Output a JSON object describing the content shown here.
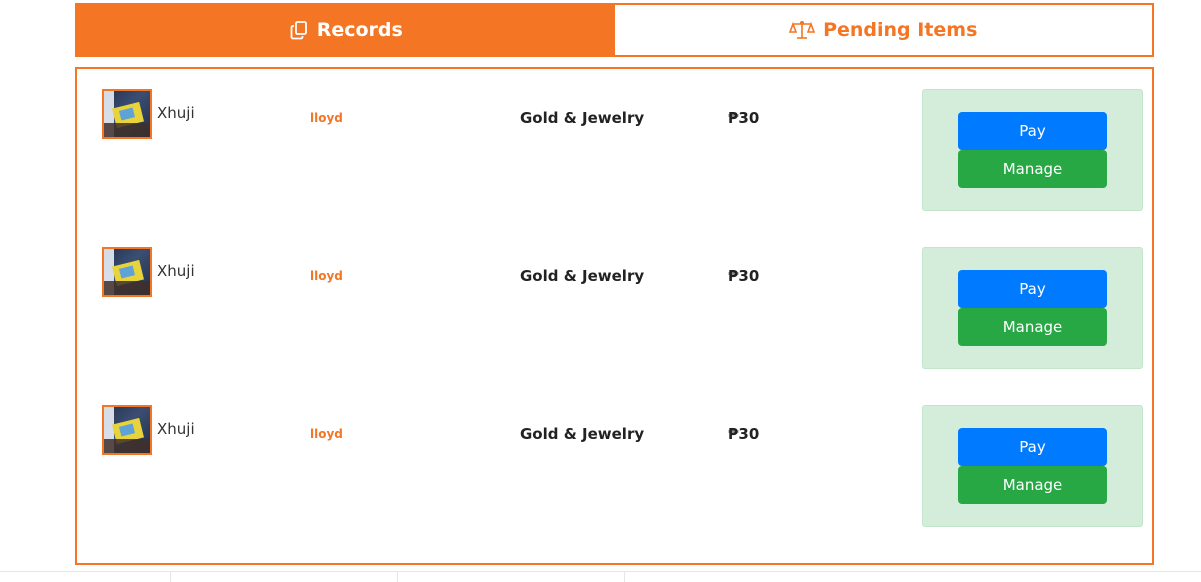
{
  "tabs": {
    "records": {
      "label": "Records",
      "icon": "copy-icon",
      "active": true
    },
    "pending": {
      "label": "Pending Items",
      "icon": "scale-icon",
      "active": false
    }
  },
  "colors": {
    "accent": "#f47624",
    "pay": "#007bff",
    "manage": "#28a745",
    "action_bg": "#d4edda"
  },
  "items": [
    {
      "name": "Xhuji",
      "seller": "lloyd",
      "category": "Gold & Jewelry",
      "price": "₱30",
      "pay_label": "Pay",
      "manage_label": "Manage"
    },
    {
      "name": "Xhuji",
      "seller": "lloyd",
      "category": "Gold & Jewelry",
      "price": "₱30",
      "pay_label": "Pay",
      "manage_label": "Manage"
    },
    {
      "name": "Xhuji",
      "seller": "lloyd",
      "category": "Gold & Jewelry",
      "price": "₱30",
      "pay_label": "Pay",
      "manage_label": "Manage"
    }
  ]
}
